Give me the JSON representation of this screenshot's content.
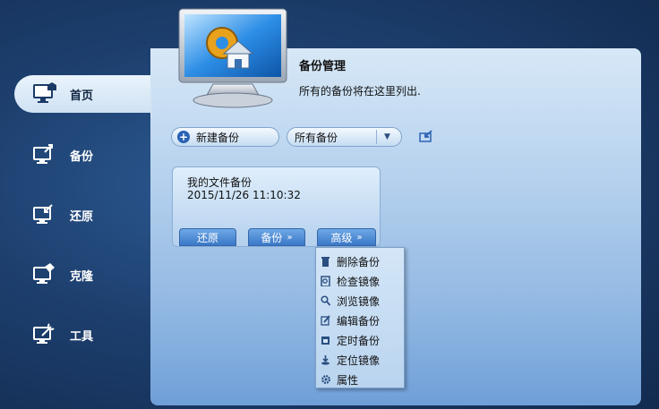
{
  "sidebar": {
    "items": [
      {
        "label": "首页",
        "icon": "home-monitor-icon",
        "active": true
      },
      {
        "label": "备份",
        "icon": "backup-monitor-icon",
        "active": false
      },
      {
        "label": "还原",
        "icon": "restore-monitor-icon",
        "active": false
      },
      {
        "label": "克隆",
        "icon": "clone-monitor-icon",
        "active": false
      },
      {
        "label": "工具",
        "icon": "tools-monitor-icon",
        "active": false
      }
    ]
  },
  "header": {
    "title": "备份管理",
    "subtitle": "所有的备份将在这里列出."
  },
  "toolbar": {
    "new_backup_label": "新建备份",
    "filter_selected": "所有备份"
  },
  "backup_card": {
    "name": "我的文件备份",
    "date": "2015/11/26 11:10:32",
    "restore_label": "还原",
    "backup_label": "备份",
    "advanced_label": "高级"
  },
  "advanced_menu": {
    "items": [
      {
        "label": "删除备份",
        "icon": "trash-icon"
      },
      {
        "label": "检查镜像",
        "icon": "check-image-icon"
      },
      {
        "label": "浏览镜像",
        "icon": "browse-image-icon"
      },
      {
        "label": "编辑备份",
        "icon": "edit-icon"
      },
      {
        "label": "定时备份",
        "icon": "schedule-icon"
      },
      {
        "label": "定位镜像",
        "icon": "locate-icon"
      },
      {
        "label": "属性",
        "icon": "gear-icon"
      }
    ]
  },
  "colors": {
    "background": "#1d3f6e",
    "panel_top": "#d7e8f7",
    "panel_bottom": "#6f9fd8",
    "card_button": "#3a78c8"
  }
}
